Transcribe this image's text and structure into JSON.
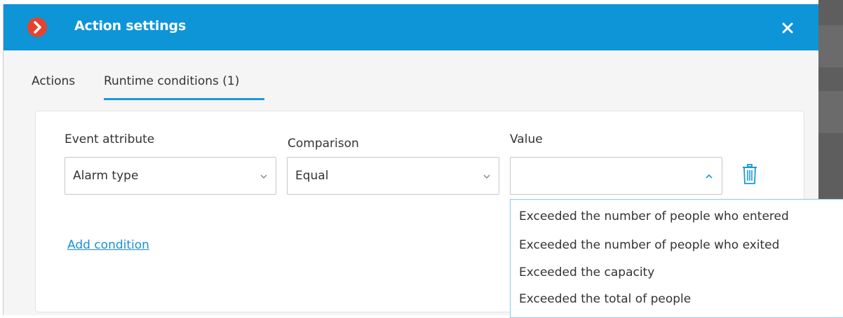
{
  "window": {
    "title": "Action settings",
    "close_icon": "close-icon",
    "logo_icon": "chevron-right-logo-icon"
  },
  "tabs": [
    {
      "label": "Actions",
      "active": false
    },
    {
      "label": "Runtime conditions (1)",
      "active": true
    }
  ],
  "condition": {
    "event_attribute": {
      "label": "Event attribute",
      "value": "Alarm type"
    },
    "comparison": {
      "label": "Comparison",
      "value": "Equal"
    },
    "value": {
      "label": "Value",
      "current": "",
      "open": true,
      "options": [
        "Exceeded the number of people who entered",
        "Exceeded the number of people who exited",
        "Exceeded the capacity",
        "Exceeded the total of people"
      ]
    },
    "delete_icon": "trash-icon"
  },
  "add_condition_label": "Add condition",
  "colors": {
    "titlebar": "#0d95d8",
    "logo": "#e5432d",
    "accent": "#1a9ad9",
    "link": "#1a8fd0"
  }
}
